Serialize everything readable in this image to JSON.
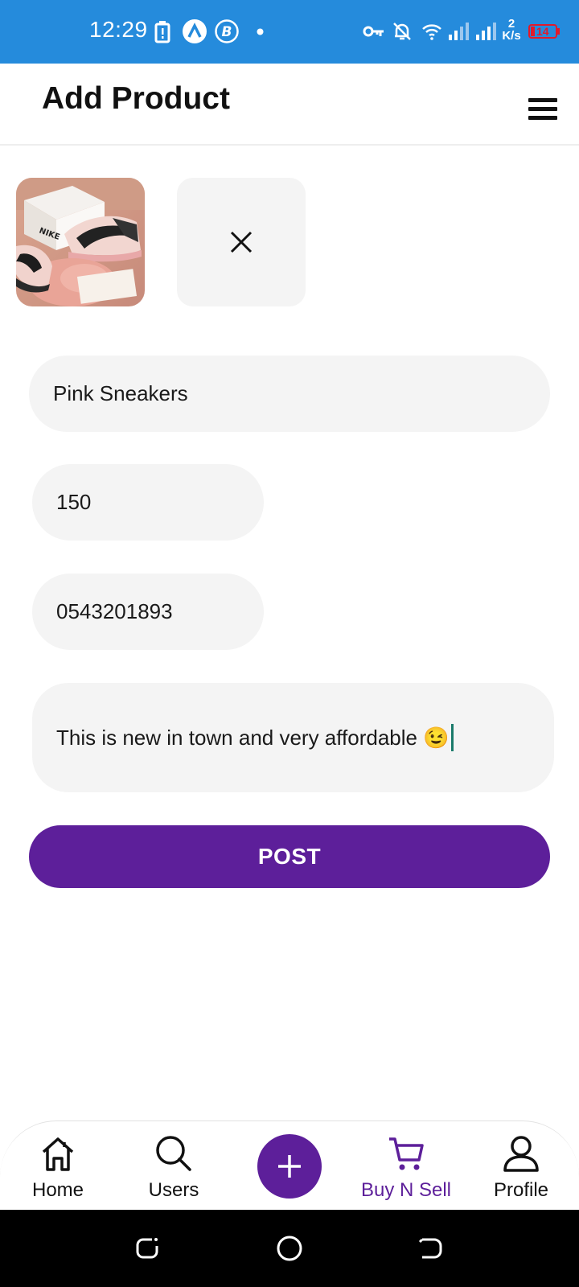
{
  "status_bar": {
    "time": "12:29",
    "network_speed_value": "2",
    "network_speed_unit": "K/s",
    "battery": "14",
    "icons": [
      "battery-saver-icon",
      "app-a-icon",
      "app-b-icon",
      "dot-icon",
      "vpn-key-icon",
      "mute-bell-icon",
      "wifi-icon",
      "signal-1-icon",
      "signal-2-icon",
      "battery-icon"
    ]
  },
  "header": {
    "title": "Add Product",
    "menu_icon": "hamburger-menu-icon"
  },
  "images": {
    "thumbnail_icon": "product-image",
    "remove_icon": "close-icon"
  },
  "form": {
    "name_value": "Pink Sneakers",
    "price_value": "150",
    "phone_value": "0543201893",
    "description_value": "This is new in town and very affordable 😉",
    "post_label": "POST"
  },
  "bottom_nav": {
    "items": [
      {
        "label": "Home",
        "icon": "home-icon"
      },
      {
        "label": "Users",
        "icon": "search-icon"
      },
      {
        "label": "",
        "icon": "plus-icon"
      },
      {
        "label": "Buy N Sell",
        "icon": "cart-icon",
        "active": true
      },
      {
        "label": "Profile",
        "icon": "person-icon"
      }
    ]
  },
  "colors": {
    "status_bar": "#258bdc",
    "accent": "#5d1f9a",
    "field_bg": "#f4f4f4"
  }
}
